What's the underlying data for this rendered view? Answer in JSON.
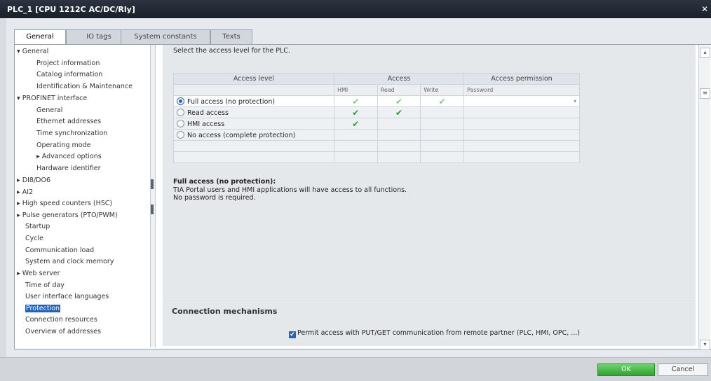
{
  "window": {
    "title": "PLC_1 [CPU 1212C AC/DC/Rly]",
    "close_glyph": "✕"
  },
  "tabs": [
    {
      "label": "General"
    },
    {
      "label": "IO tags"
    },
    {
      "label": "System constants"
    },
    {
      "label": "Texts"
    }
  ],
  "tree": [
    {
      "label": "▾ General"
    },
    {
      "label": "Project information"
    },
    {
      "label": "Catalog information"
    },
    {
      "label": "Identification & Maintenance"
    },
    {
      "label": "▾ PROFINET interface"
    },
    {
      "label": "General"
    },
    {
      "label": "Ethernet addresses"
    },
    {
      "label": "Time synchronization"
    },
    {
      "label": "Operating mode"
    },
    {
      "label": "▸ Advanced options"
    },
    {
      "label": "Hardware identifier"
    },
    {
      "label": "▸ DI8/DO6"
    },
    {
      "label": "▸ AI2"
    },
    {
      "label": "▸ High speed counters (HSC)"
    },
    {
      "label": "▸ Pulse generators (PTO/PWM)"
    },
    {
      "label": "Startup"
    },
    {
      "label": "Cycle"
    },
    {
      "label": "Communication load"
    },
    {
      "label": "System and clock memory"
    },
    {
      "label": "▸ Web server"
    },
    {
      "label": "Time of day"
    },
    {
      "label": "User interface languages"
    },
    {
      "label": "Protection"
    },
    {
      "label": "Connection resources"
    },
    {
      "label": "Overview of addresses"
    }
  ],
  "protection": {
    "intro": "Select the access level for the PLC.",
    "headers": {
      "access_level": "Access level",
      "access": "Access",
      "access_permission": "Access permission",
      "hmi": "HMI",
      "read": "Read",
      "write": "Write",
      "password": "Password"
    },
    "rows": [
      {
        "label": "Full access (no protection)"
      },
      {
        "label": "Read access"
      },
      {
        "label": "HMI access"
      },
      {
        "label": "No access (complete protection)"
      }
    ],
    "check_glyph": "✔",
    "desc_title": "Full access (no protection):",
    "desc_line1": "TIA Portal users and HMI applications will have access to all functions.",
    "desc_line2": "No password is required."
  },
  "connection": {
    "heading": "Connection mechanisms",
    "checkbox_label": "Permit access with PUT/GET communication from remote partner (PLC, HMI, OPC, ...)",
    "check_glyph": "✔"
  },
  "buttons": {
    "ok": "OK",
    "cancel": "Cancel"
  },
  "scrollbar": {
    "up": "▴",
    "down": "▾",
    "grip": "≡"
  },
  "colors": {
    "selection": "#1f62c2",
    "ok_button": "#2ea22e",
    "check": "#2aa02a"
  }
}
